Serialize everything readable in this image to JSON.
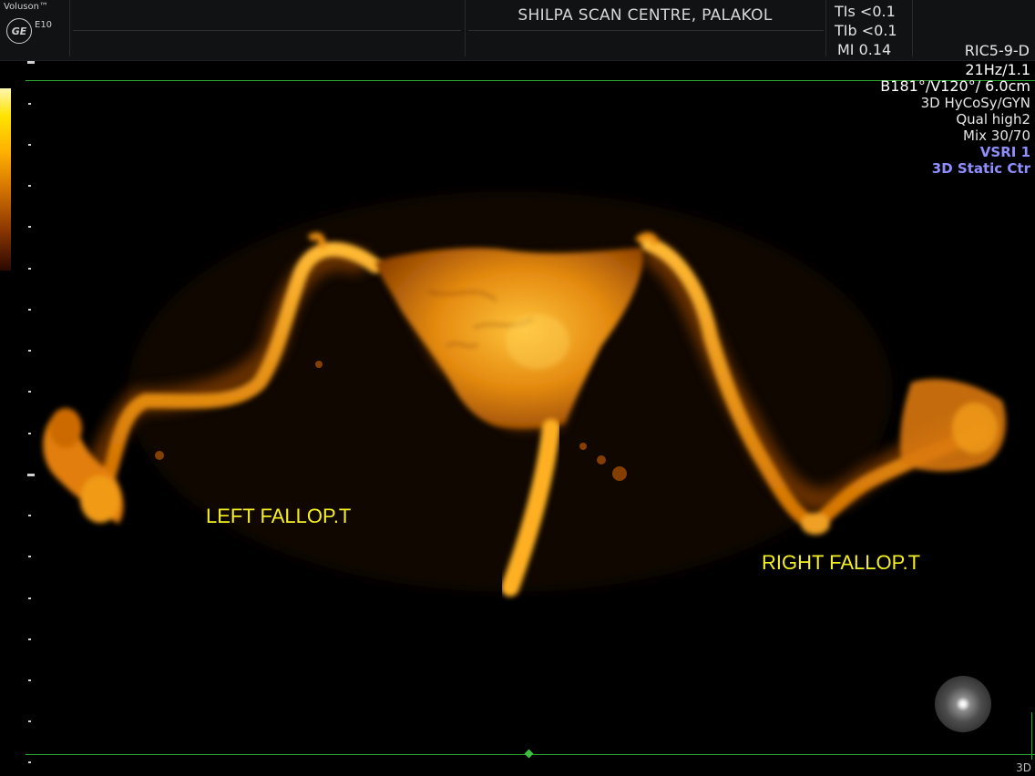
{
  "header": {
    "brand": "Voluson™",
    "logo": "GE",
    "model": "E10",
    "clinic": "SHILPA SCAN CENTRE, PALAKOL",
    "tis": "TIs <0.1",
    "tib": "TIb <0.1",
    "mi": "MI 0.14",
    "probe": "RIC5-9-D"
  },
  "params": {
    "frame_rate": "21Hz/1.1",
    "volume": "B181°/V120°/ 6.0cm",
    "preset": "3D HyCoSy/GYN",
    "quality": "Qual high2",
    "mix": "Mix 30/70",
    "vsri": "VSRI 1",
    "mode": "3D Static Ctr"
  },
  "labels": {
    "left": "LEFT FALLOP.T",
    "right": "RIGHT FALLOP.T"
  },
  "footer": {
    "mode": "3D"
  },
  "colors": {
    "annotation": "#f4f021",
    "frame_line": "#2fa82f",
    "highlight_param": "#8f8fff",
    "render_core": "#ffb21e"
  },
  "icons": [
    "ge-logo-icon",
    "orientation-sphere-icon"
  ]
}
